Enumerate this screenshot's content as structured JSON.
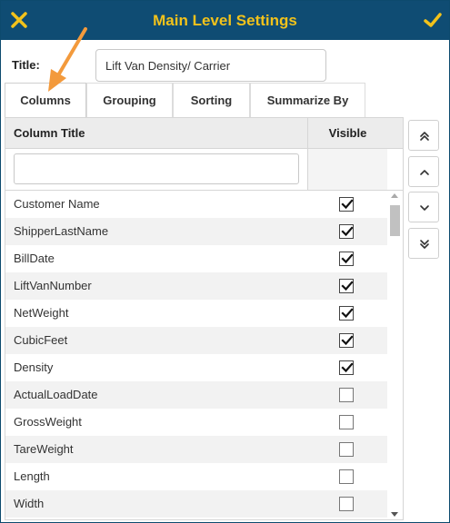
{
  "dialog": {
    "title": "Main Level Settings",
    "colors": {
      "titlebar": "#0f4c73",
      "accent": "#f2c21b",
      "arrow": "#f39a3c"
    }
  },
  "form": {
    "title_label": "Title:",
    "title_value": "Lift Van Density/ Carrier"
  },
  "tabs": [
    {
      "label": "Columns",
      "active": true
    },
    {
      "label": "Grouping",
      "active": false
    },
    {
      "label": "Sorting",
      "active": false
    },
    {
      "label": "Summarize By",
      "active": false
    }
  ],
  "grid": {
    "headers": {
      "column_title": "Column Title",
      "visible": "Visible"
    },
    "filter_value": "",
    "rows": [
      {
        "name": "Customer Name",
        "visible": true
      },
      {
        "name": "ShipperLastName",
        "visible": true
      },
      {
        "name": "BillDate",
        "visible": true
      },
      {
        "name": "LiftVanNumber",
        "visible": true
      },
      {
        "name": "NetWeight",
        "visible": true
      },
      {
        "name": "CubicFeet",
        "visible": true
      },
      {
        "name": "Density",
        "visible": true
      },
      {
        "name": "ActualLoadDate",
        "visible": false
      },
      {
        "name": "GrossWeight",
        "visible": false
      },
      {
        "name": "TareWeight",
        "visible": false
      },
      {
        "name": "Length",
        "visible": false
      },
      {
        "name": "Width",
        "visible": false
      }
    ]
  },
  "move_buttons": [
    "move-to-top-icon",
    "move-up-icon",
    "move-down-icon",
    "move-to-bottom-icon"
  ]
}
